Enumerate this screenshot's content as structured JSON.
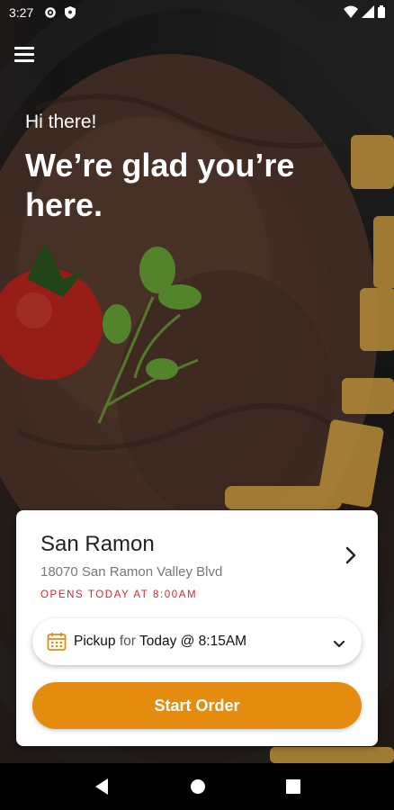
{
  "status_bar": {
    "time": "3:27",
    "icons": [
      "settings-icon",
      "shield-icon",
      "wifi-icon",
      "signal-icon",
      "battery-icon"
    ]
  },
  "hero": {
    "greeting": "Hi there!",
    "headline": "We’re glad you’re here."
  },
  "location": {
    "name": "San Ramon",
    "address": "18070 San Ramon Valley Blvd",
    "hours_status": "OPENS TODAY AT 8:00AM"
  },
  "order_time": {
    "mode": "Pickup",
    "connector": "for",
    "time": "Today @ 8:15AM"
  },
  "actions": {
    "start_order_label": "Start Order"
  },
  "colors": {
    "accent": "#e38c10",
    "hours_status": "#d4262b",
    "nav_background": "#000000"
  },
  "nav_bar": {
    "icons": [
      "back-icon",
      "home-icon",
      "recents-icon"
    ]
  }
}
